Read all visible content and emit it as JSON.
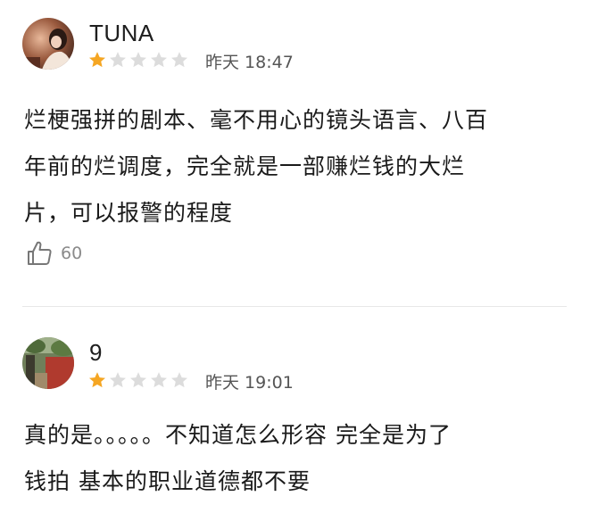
{
  "reviews": [
    {
      "username": "TUNA",
      "rating": 1,
      "max_rating": 5,
      "time": "昨天 18:47",
      "content_lines": [
        "烂梗强拼的剧本、毫不用心的镜头语言、八百",
        "年前的烂调度，完全就是一部赚烂钱的大烂",
        "片，可以报警的程度"
      ],
      "like_count": "60"
    },
    {
      "username": "9",
      "rating": 1,
      "max_rating": 5,
      "time": "昨天 19:01",
      "content_lines": [
        "真的是。。。。。不知道怎么形容 完全是为了",
        "钱拍 基本的职业道德都不要"
      ]
    }
  ],
  "colors": {
    "star_filled": "#F5A623",
    "star_empty": "#DCDCDC",
    "text": "#1A1A1A",
    "meta": "#555555",
    "like": "#8A8A8A"
  },
  "icons": {
    "like": "thumbs-up-icon",
    "star": "star-icon"
  }
}
